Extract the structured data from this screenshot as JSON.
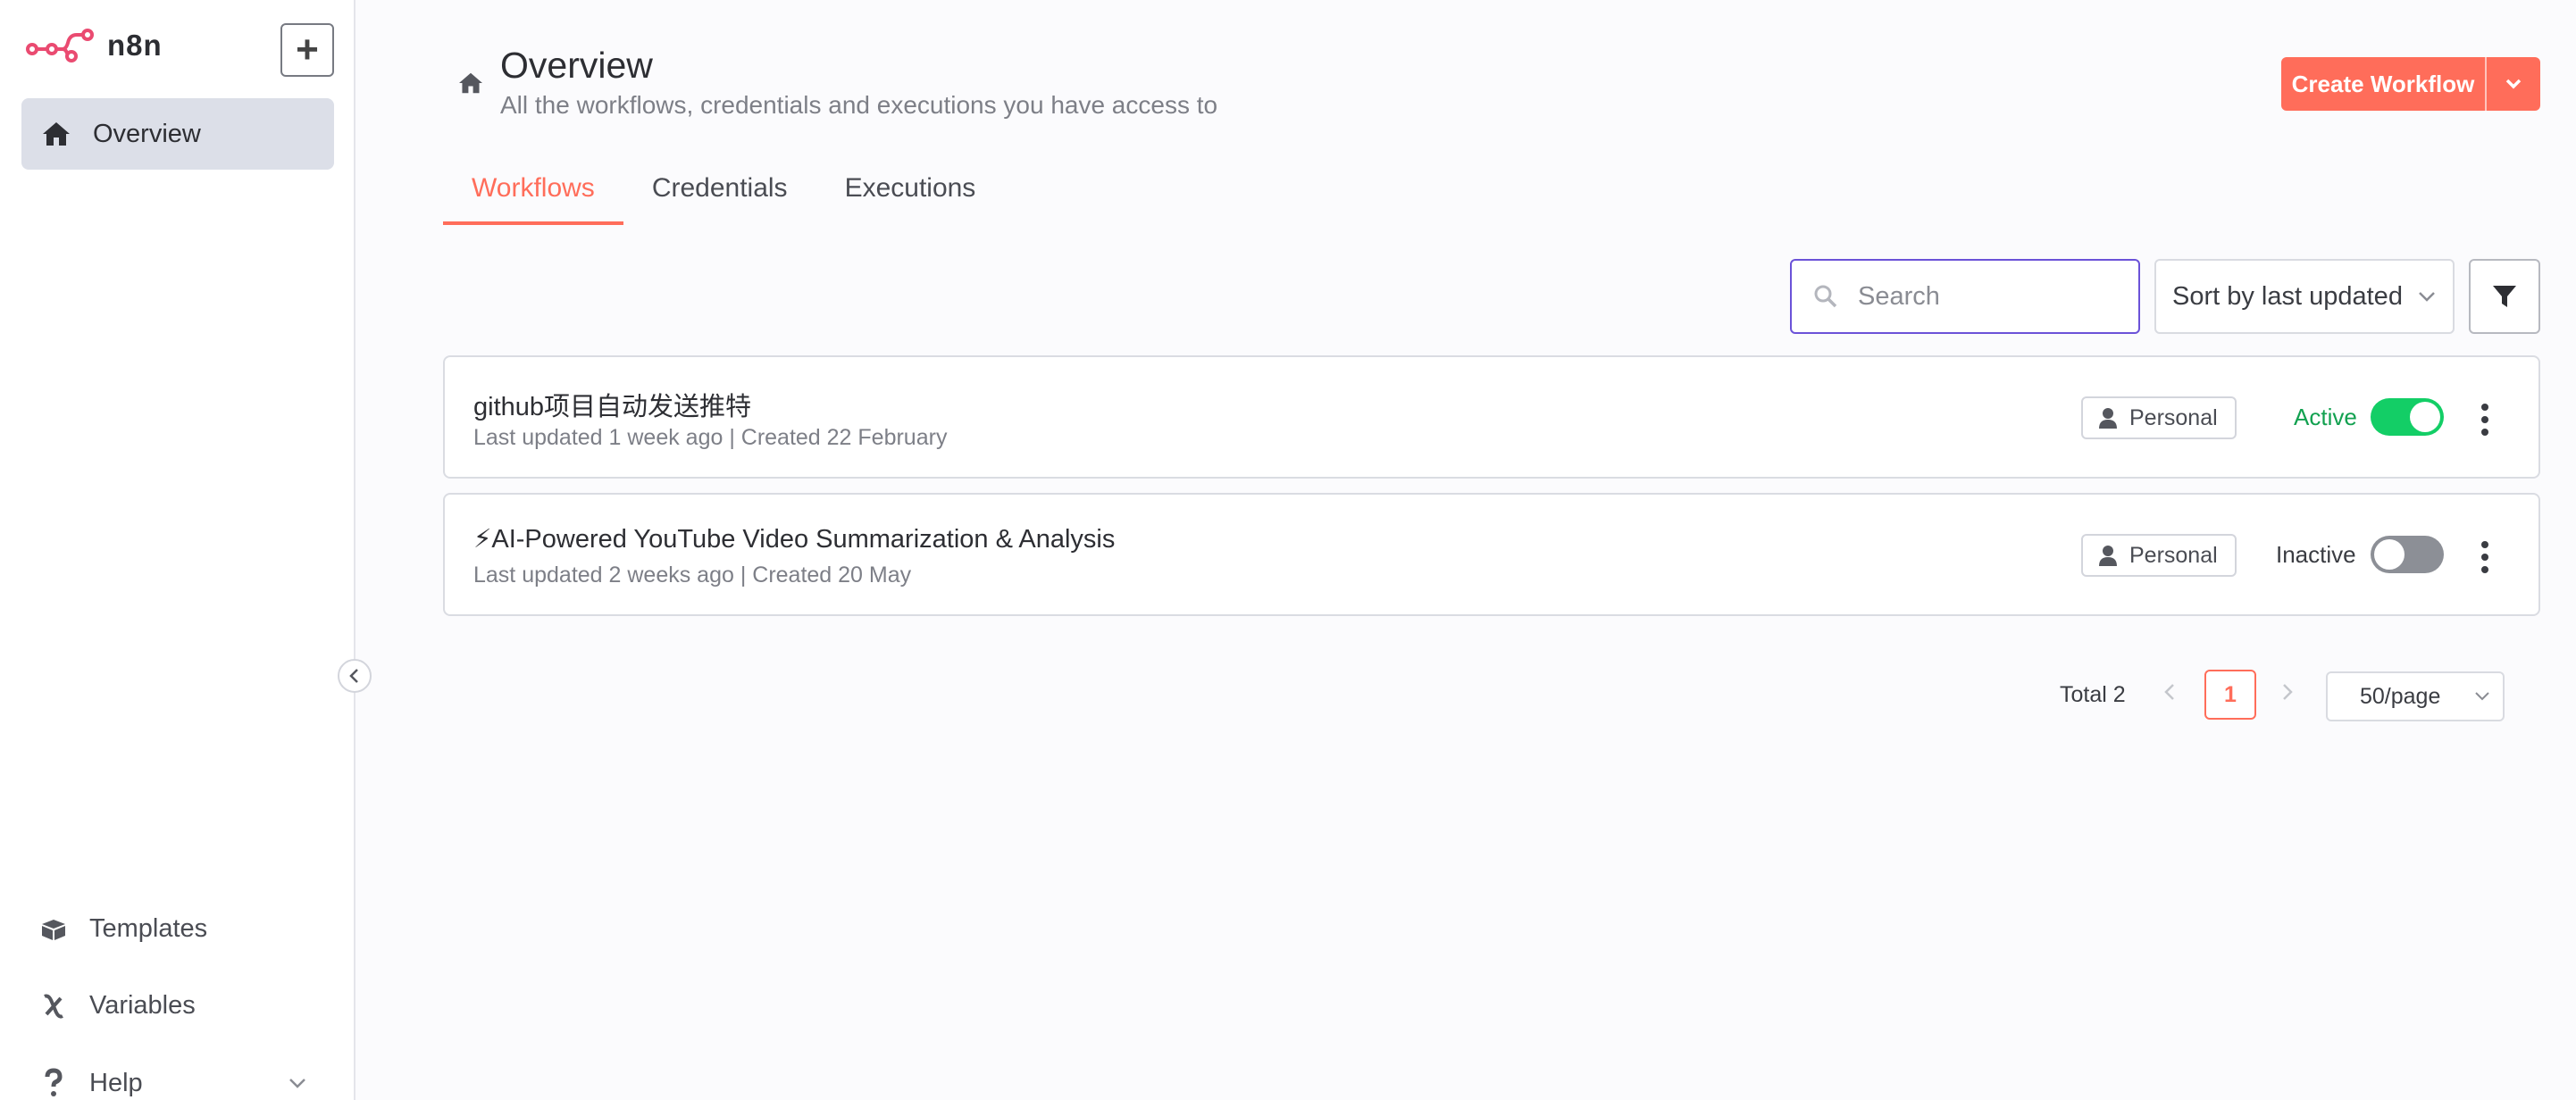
{
  "app": {
    "name": "n8n",
    "brand_color": "#ff6d5a",
    "accent_color": "#6b52d8"
  },
  "sidebar": {
    "add_label": "+",
    "items": [
      {
        "label": "Overview",
        "icon": "home-icon",
        "active": true
      }
    ],
    "bottom_items": [
      {
        "label": "Templates",
        "icon": "box-icon"
      },
      {
        "label": "Variables",
        "icon": "variable-icon"
      },
      {
        "label": "Help",
        "icon": "question-icon"
      }
    ]
  },
  "header": {
    "title": "Overview",
    "subtitle": "All the workflows, credentials and executions you have access to",
    "create_button": "Create Workflow"
  },
  "tabs": [
    {
      "label": "Workflows",
      "active": true
    },
    {
      "label": "Credentials",
      "active": false
    },
    {
      "label": "Executions",
      "active": false
    }
  ],
  "toolbar": {
    "search_placeholder": "Search",
    "sort_label": "Sort by last updated"
  },
  "workflows": [
    {
      "title": "github项目自动发送推特",
      "meta": "Last updated 1 week ago | Created 22 February",
      "owner": "Personal",
      "status": "Active",
      "active": true
    },
    {
      "title": "⚡AI-Powered YouTube Video Summarization & Analysis",
      "meta": "Last updated 2 weeks ago | Created 20 May",
      "owner": "Personal",
      "status": "Inactive",
      "active": false
    }
  ],
  "pagination": {
    "total": "Total 2",
    "current_page": "1",
    "page_size": "50/page"
  },
  "colors": {
    "active_green": "#13ce66",
    "active_text": "#12a150",
    "inactive_grey": "#8c8f96"
  }
}
